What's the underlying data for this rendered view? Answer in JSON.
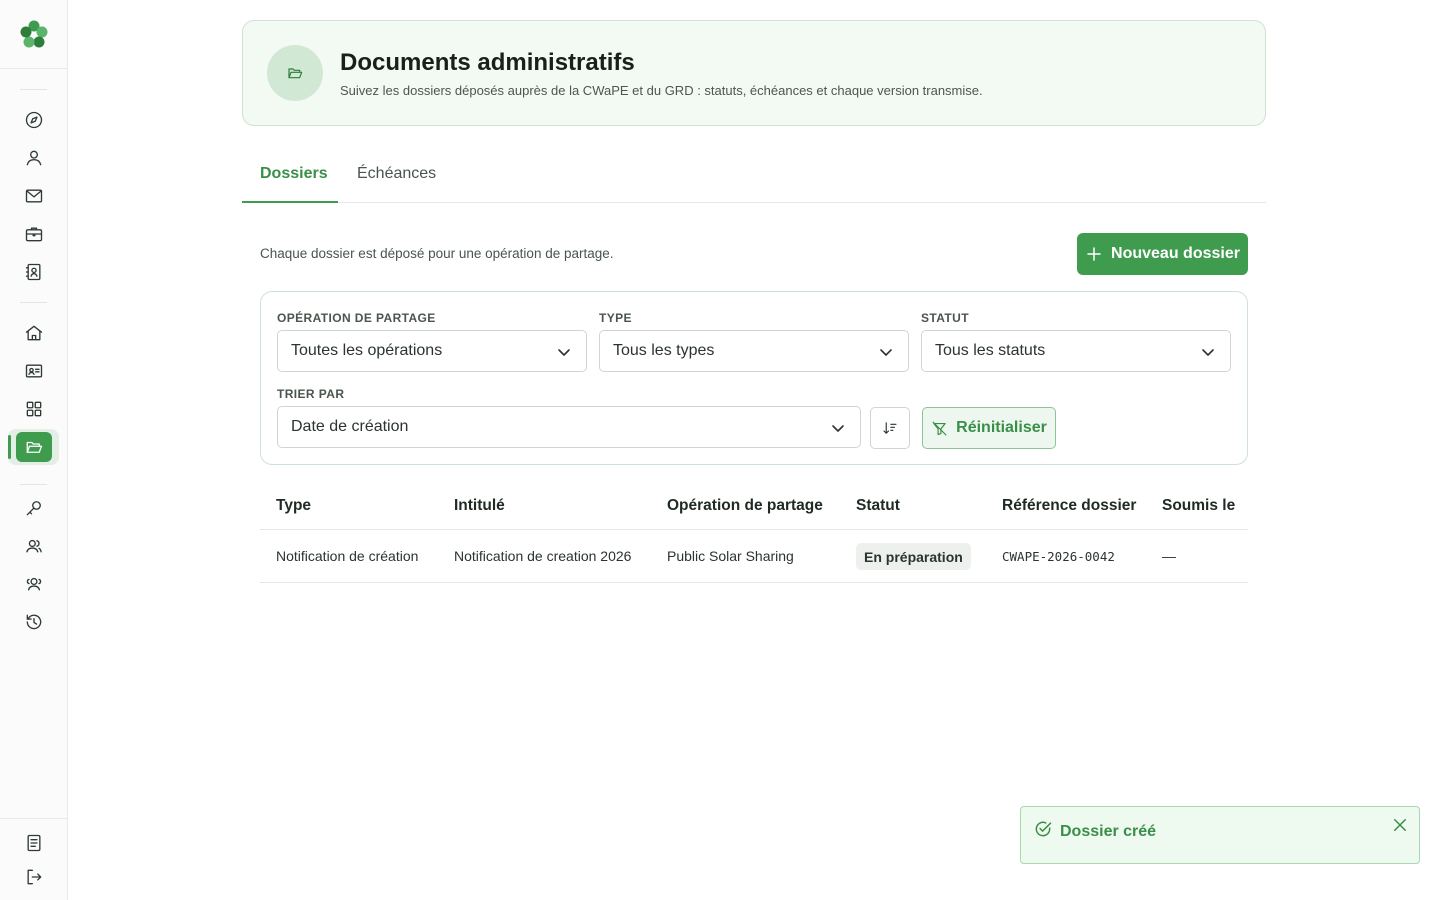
{
  "app": {
    "logo": "clover-logo"
  },
  "sidebar": {
    "items": [
      {
        "icon": "compass-icon",
        "label": ""
      },
      {
        "icon": "user-icon",
        "label": ""
      },
      {
        "icon": "mail-icon",
        "label": ""
      },
      {
        "icon": "briefcase-icon",
        "label": ""
      },
      {
        "icon": "contacts-book-icon",
        "label": ""
      },
      {
        "icon": "home-icon",
        "label": ""
      },
      {
        "icon": "id-card-icon",
        "label": ""
      },
      {
        "icon": "grid-icon",
        "label": ""
      },
      {
        "icon": "folder-open-icon",
        "label": "",
        "active": true
      },
      {
        "icon": "key-icon",
        "label": ""
      },
      {
        "icon": "users-icon",
        "label": ""
      },
      {
        "icon": "team-icon",
        "label": ""
      },
      {
        "icon": "history-icon",
        "label": ""
      }
    ],
    "footer": [
      {
        "icon": "document-icon"
      },
      {
        "icon": "logout-icon"
      }
    ]
  },
  "header": {
    "title": "Documents administratifs",
    "subtitle": "Suivez les dossiers déposés auprès de la CWaPE et du GRD : statuts, échéances et chaque version transmise.",
    "icon": "folder-open-icon"
  },
  "tabs": [
    {
      "label": "Dossiers",
      "active": true
    },
    {
      "label": "Échéances",
      "active": false
    }
  ],
  "intro": "Chaque dossier est déposé pour une opération de partage.",
  "new_button": {
    "label": "Nouveau dossier"
  },
  "filters": {
    "operation": {
      "label": "OPÉRATION DE PARTAGE",
      "value": "Toutes les opérations"
    },
    "type": {
      "label": "TYPE",
      "value": "Tous les types"
    },
    "status": {
      "label": "STATUT",
      "value": "Tous les statuts"
    },
    "sort": {
      "label": "TRIER PAR",
      "value": "Date de création"
    },
    "reset_label": "Réinitialiser"
  },
  "table": {
    "columns": [
      "Type",
      "Intitulé",
      "Opération de partage",
      "Statut",
      "Référence dossier",
      "Soumis le"
    ],
    "rows": [
      {
        "type": "Notification de création",
        "title": "Notification de creation 2026",
        "operation": "Public Solar Sharing",
        "status": "En préparation",
        "reference": "CWAPE-2026-0042",
        "submitted": "—"
      }
    ]
  },
  "toast": {
    "message": "Dossier créé",
    "color": "#3a8f48"
  },
  "colors": {
    "accent": "#3f9c4f",
    "accent_soft": "#f3f9f3",
    "border": "#cfe3d2"
  }
}
